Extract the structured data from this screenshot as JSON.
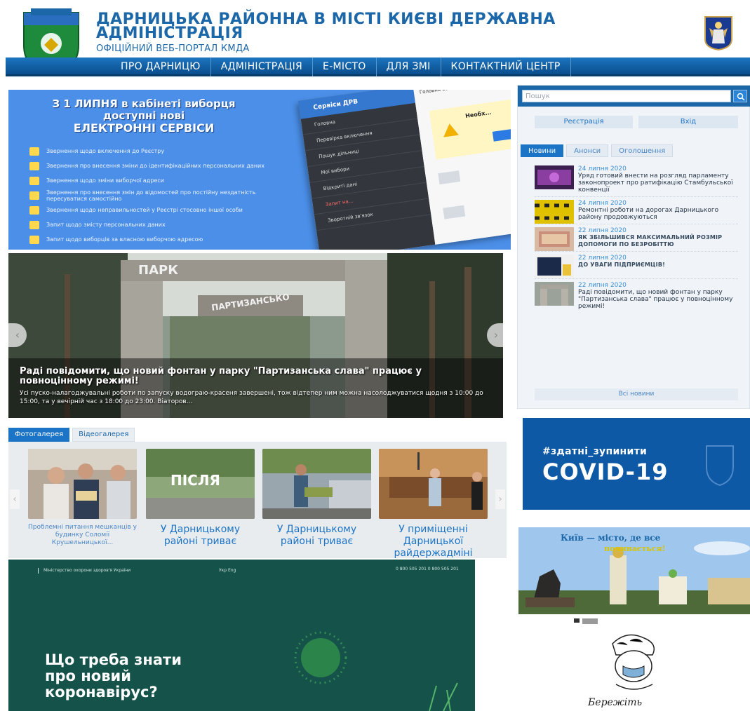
{
  "header": {
    "title": "ДАРНИЦЬКА РАЙОННА В МІСТІ КИЄВІ ДЕРЖАВНА АДМІНІСТРАЦІЯ",
    "subtitle": "ОФІЦІЙНИЙ ВЕБ-ПОРТАЛ КМДА"
  },
  "nav": {
    "items": [
      "ПРО ДАРНИЦЮ",
      "АДМІНІСТРАЦІЯ",
      "Е-МІСТО",
      "ДЛЯ ЗМІ",
      "КОНТАКТНИЙ ЦЕНТР"
    ]
  },
  "promo": {
    "title_line1": "З 1 ЛИПНЯ в кабінеті виборця",
    "title_line2": "доступні нові",
    "title_line3": "ЕЛЕКТРОННІ СЕРВІСИ",
    "services": [
      "Звернення щодо включення до Реєстру",
      "Звернення про внесення зміни до ідентифікаційних персональних даних",
      "Звернення щодо зміни виборчої адреси",
      "Звернення про внесення змін до відомостей про постійну нездатність пересуватися самостійно",
      "Звернення щодо неправильностей у Реєстрі стосовно іншої особи",
      "Запит щодо змісту персональних даних",
      "Запит щодо виборців за власною виборчою адресою"
    ],
    "mock": {
      "header": "Сервіси ДРВ",
      "menu": [
        "Головна",
        "Перевірка включення",
        "Пошук дільниці",
        "Мої вибори",
        "Відкриті дані",
        "Запит на...",
        "Зворотній зв'язок"
      ],
      "tabs": "Головна   Запит...",
      "warn": "Необх..."
    }
  },
  "slider": {
    "park_sign": "ПАРК",
    "park_sign2": "ПАРТИЗАНСЬКО",
    "title": "Раді повідомити, що новий фонтан у парку \"Партизанська слава\" працює у повноцінному режимі!",
    "text": "Усі пуско-налагоджувальні роботи по запуску водограю-красеня завершені, тож відтепер ним можна насолоджуватися щодня з 10:00 до 15:00, та у вечірній час з 18:00 до 23:00. Віаторов..."
  },
  "gallery": {
    "tabs": [
      "Фотогалерея",
      "Відеогалерея"
    ],
    "items": [
      {
        "caption": "Проблемні питання мешканців у будинку Соломії Крушельницької..."
      },
      {
        "caption": "У Дарницькому районі триває",
        "overlay": "ПІСЛЯ"
      },
      {
        "caption": "У Дарницькому районі триває"
      },
      {
        "caption": "У приміщенні Дарницької райдержадміні"
      }
    ]
  },
  "virus": {
    "ministry": "Міністерство охорони здоров'я України",
    "menu": "Укр  Eng",
    "phones": "0 800 505 201 0 800 505 201",
    "headline_lines": [
      "Що треба знати",
      "про новий",
      "коронавірус?"
    ]
  },
  "sidebar": {
    "search_placeholder": "Пошук",
    "register": "Реєстрація",
    "login": "Вхід",
    "tabs": [
      "Новини",
      "Анонси",
      "Оголошення"
    ],
    "news": [
      {
        "date": "24 липня 2020",
        "title": "Уряд готовий внести на розгляд парламенту законопроект про ратифікацію Стамбульської конвенції"
      },
      {
        "date": "24 липня 2020",
        "title": "Ремонтні роботи на дорогах Дарницького району продовжуються"
      },
      {
        "date": "22 липня 2020",
        "title": "ЯК ЗБІЛЬШИВСЯ МАКСИМАЛЬНИЙ РОЗМІР ДОПОМОГИ ПО БЕЗРОБІТТЮ"
      },
      {
        "date": "22 липня 2020",
        "title": "ДО УВАГИ ПІДПРИЄМЦІВ!"
      },
      {
        "date": "22 липня 2020",
        "title": "Раді повідомити, що новий фонтан у парку \"Партизанська слава\" працює у повноцінному режимі!"
      }
    ],
    "all_news": "Всі новини"
  },
  "covid": {
    "tag": "#здатні_зупинити",
    "big": "COVID-19"
  },
  "kyiv_banner": {
    "text1": "Київ — місто, де все",
    "text2": "починається!"
  },
  "poster": {
    "script": "Бережіть"
  },
  "colors": {
    "brand_blue": "#1b67a8",
    "nav_blue": "#0a4d8c",
    "accent": "#1b74c5",
    "covid_blue": "#0e59a6",
    "virus_green": "#15524a"
  }
}
